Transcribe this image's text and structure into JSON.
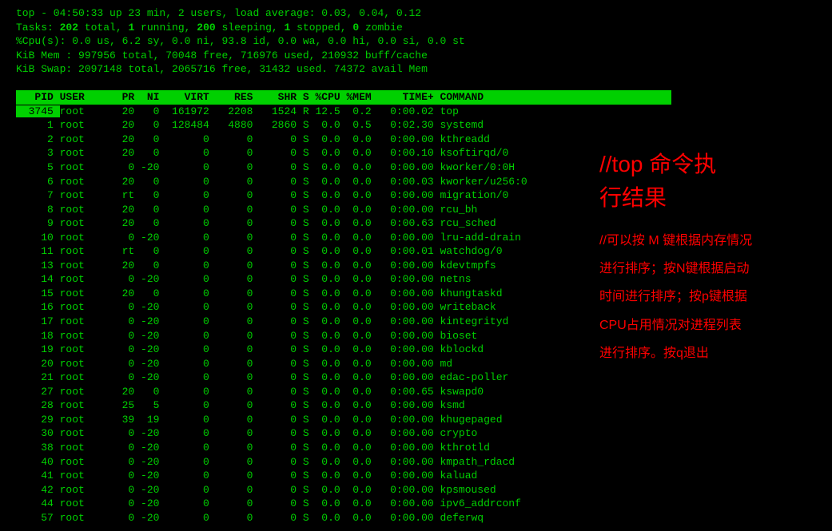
{
  "summary": {
    "line1": "top - 04:50:33 up 23 min,  2 users,  load average: 0.03, 0.04, 0.12",
    "line2_a": "Tasks: ",
    "line2_b": "202 ",
    "line2_c": "total,   ",
    "line2_d": "1 ",
    "line2_e": "running, ",
    "line2_f": "200 ",
    "line2_g": "sleeping,   ",
    "line2_h": "1 ",
    "line2_i": "stopped,   ",
    "line2_j": "0 ",
    "line2_k": "zombie",
    "line3": "%Cpu(s):  0.0 us,  6.2 sy,  0.0 ni, 93.8 id,  0.0 wa,  0.0 hi,  0.0 si,  0.0 st",
    "line4": "KiB Mem :   997956 total,    70048 free,   716976 used,   210932 buff/cache",
    "line5": "KiB Swap:  2097148 total,  2065716 free,    31432 used.    74372 avail Mem"
  },
  "header": "   PID USER      PR  NI    VIRT    RES    SHR S %CPU %MEM     TIME+ COMMAND                          ",
  "highlight_prefix": "  3745 ",
  "highlight_rest": "root      20   0  161972   2208   1524 R 12.5  0.2   0:00.02 top",
  "processes": [
    "     1 root      20   0  128484   4880   2860 S  0.0  0.5   0:02.30 systemd",
    "     2 root      20   0       0      0      0 S  0.0  0.0   0:00.00 kthreadd",
    "     3 root      20   0       0      0      0 S  0.0  0.0   0:00.10 ksoftirqd/0",
    "     5 root       0 -20       0      0      0 S  0.0  0.0   0:00.00 kworker/0:0H",
    "     6 root      20   0       0      0      0 S  0.0  0.0   0:00.03 kworker/u256:0",
    "     7 root      rt   0       0      0      0 S  0.0  0.0   0:00.00 migration/0",
    "     8 root      20   0       0      0      0 S  0.0  0.0   0:00.00 rcu_bh",
    "     9 root      20   0       0      0      0 S  0.0  0.0   0:00.63 rcu_sched",
    "    10 root       0 -20       0      0      0 S  0.0  0.0   0:00.00 lru-add-drain",
    "    11 root      rt   0       0      0      0 S  0.0  0.0   0:00.01 watchdog/0",
    "    13 root      20   0       0      0      0 S  0.0  0.0   0:00.00 kdevtmpfs",
    "    14 root       0 -20       0      0      0 S  0.0  0.0   0:00.00 netns",
    "    15 root      20   0       0      0      0 S  0.0  0.0   0:00.00 khungtaskd",
    "    16 root       0 -20       0      0      0 S  0.0  0.0   0:00.00 writeback",
    "    17 root       0 -20       0      0      0 S  0.0  0.0   0:00.00 kintegrityd",
    "    18 root       0 -20       0      0      0 S  0.0  0.0   0:00.00 bioset",
    "    19 root       0 -20       0      0      0 S  0.0  0.0   0:00.00 kblockd",
    "    20 root       0 -20       0      0      0 S  0.0  0.0   0:00.00 md",
    "    21 root       0 -20       0      0      0 S  0.0  0.0   0:00.00 edac-poller",
    "    27 root      20   0       0      0      0 S  0.0  0.0   0:00.65 kswapd0",
    "    28 root      25   5       0      0      0 S  0.0  0.0   0:00.00 ksmd",
    "    29 root      39  19       0      0      0 S  0.0  0.0   0:00.00 khugepaged",
    "    30 root       0 -20       0      0      0 S  0.0  0.0   0:00.00 crypto",
    "    38 root       0 -20       0      0      0 S  0.0  0.0   0:00.00 kthrotld",
    "    40 root       0 -20       0      0      0 S  0.0  0.0   0:00.00 kmpath_rdacd",
    "    41 root       0 -20       0      0      0 S  0.0  0.0   0:00.00 kaluad",
    "    42 root       0 -20       0      0      0 S  0.0  0.0   0:00.00 kpsmoused",
    "    44 root       0 -20       0      0      0 S  0.0  0.0   0:00.00 ipv6_addrconf",
    "    57 root       0 -20       0      0      0 S  0.0  0.0   0:00.00 deferwq"
  ],
  "annotations": {
    "title1": "//top 命令执",
    "title2": "行结果",
    "line1": "//可以按 M 键根据内存情况",
    "line2": "进行排序；按N键根据启动",
    "line3": "时间进行排序；按p键根据",
    "line4": "CPU占用情况对进程列表",
    "line5": "进行排序。按q退出"
  }
}
